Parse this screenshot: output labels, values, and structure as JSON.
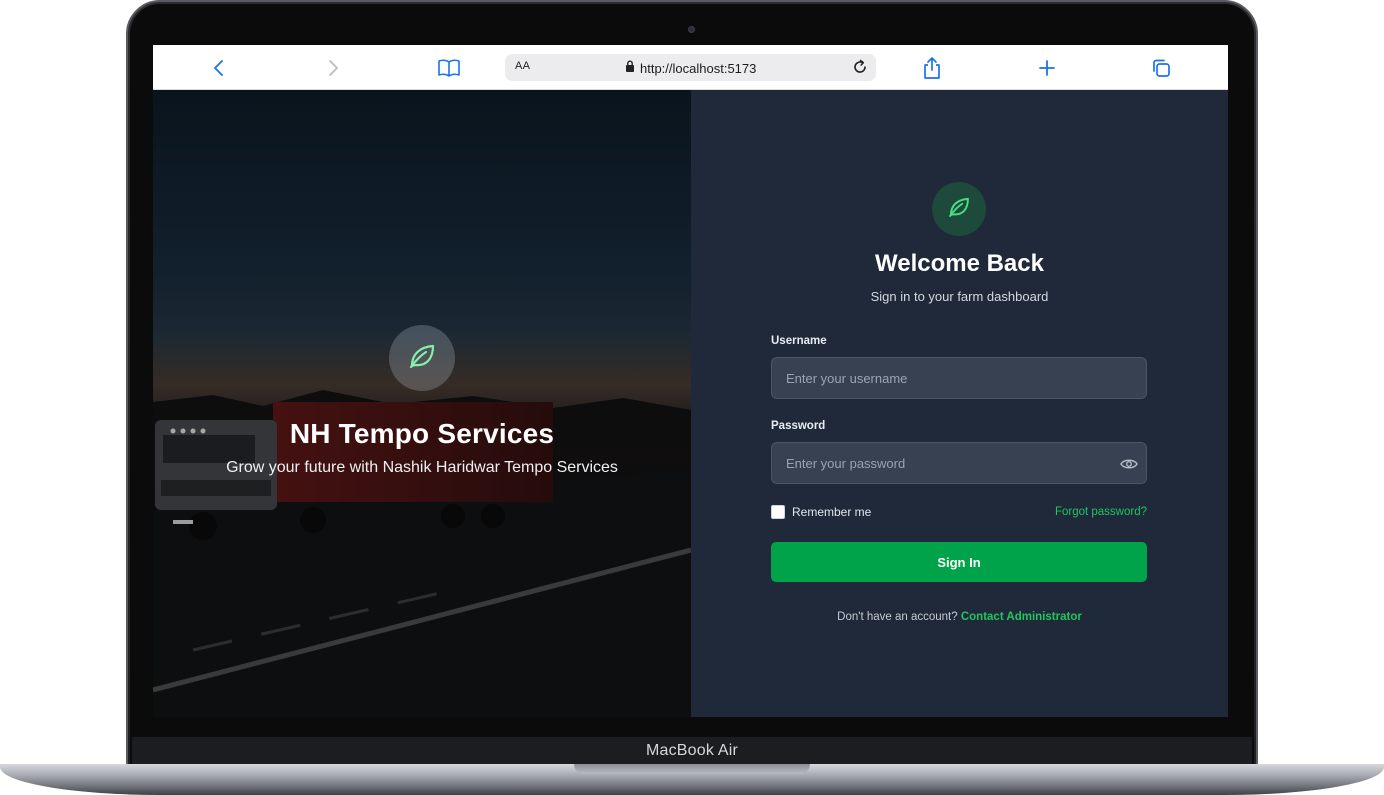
{
  "device": {
    "label": "MacBook Air"
  },
  "browser": {
    "text_size_label": "AA",
    "url": "http://localhost:5173",
    "icons": [
      "chevron-left-icon",
      "chevron-right-icon",
      "book-icon",
      "lock-icon",
      "reload-icon",
      "share-icon",
      "plus-icon",
      "tabs-icon"
    ]
  },
  "hero": {
    "title": "NH Tempo Services",
    "subtitle": "Grow your future with Nashik Haridwar Tempo Services",
    "icon": "leaf-icon"
  },
  "login": {
    "icon": "leaf-icon",
    "title": "Welcome Back",
    "subtitle": "Sign in to your farm dashboard",
    "username_label": "Username",
    "username_placeholder": "Enter your username",
    "password_label": "Password",
    "password_placeholder": "Enter your password",
    "remember_label": "Remember me",
    "forgot_label": "Forgot password?",
    "signin_label": "Sign In",
    "footer_text": "Don't have an account?",
    "contact_label": "Contact Administrator"
  },
  "colors": {
    "accent": "#22c55e",
    "button": "#00a34a",
    "panel": "#1f2939",
    "input": "#374151"
  }
}
